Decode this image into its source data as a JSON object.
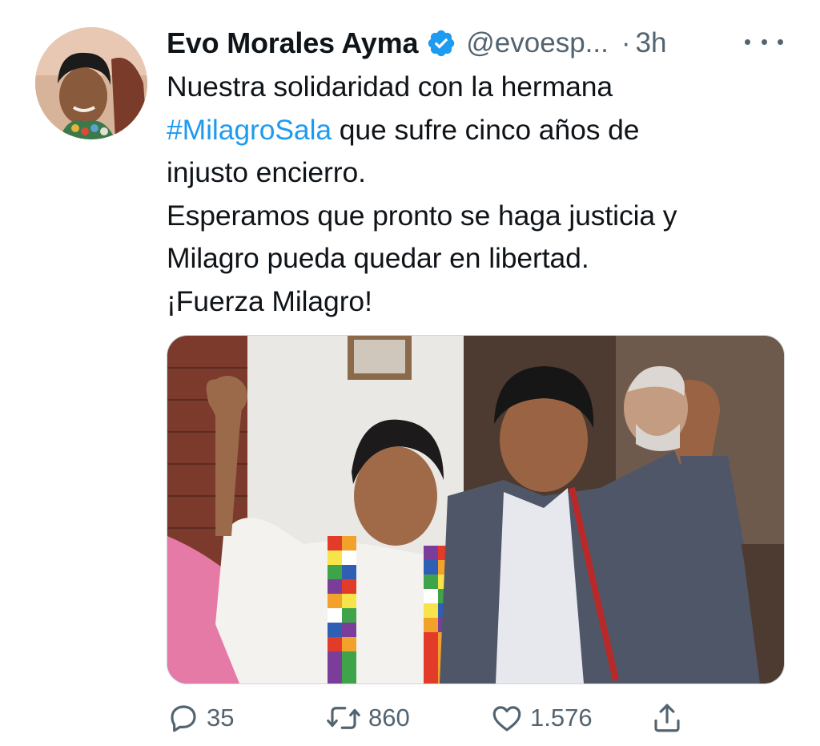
{
  "colors": {
    "accent": "#1d9bf0",
    "muted": "#536471",
    "text": "#0f1419"
  },
  "author": {
    "name": "Evo Morales Ayma",
    "verified_icon": "verified-badge-icon",
    "handle": "@evoesp...",
    "separator": "·",
    "time": "3h"
  },
  "tweet": {
    "line1": "Nuestra solidaridad con la hermana",
    "hashtag": "#MilagroSala",
    "line2_rest": " que sufre cinco años de",
    "line3": "injusto encierro.",
    "line4": "Esperamos que pronto se haga justicia y",
    "line5": "Milagro pueda quedar en libertad.",
    "line6": "¡Fuerza Milagro!"
  },
  "actions": {
    "replies": "35",
    "retweets": "860",
    "likes": "1.576",
    "icons": [
      "reply-icon",
      "retweet-icon",
      "like-icon",
      "share-icon"
    ]
  }
}
